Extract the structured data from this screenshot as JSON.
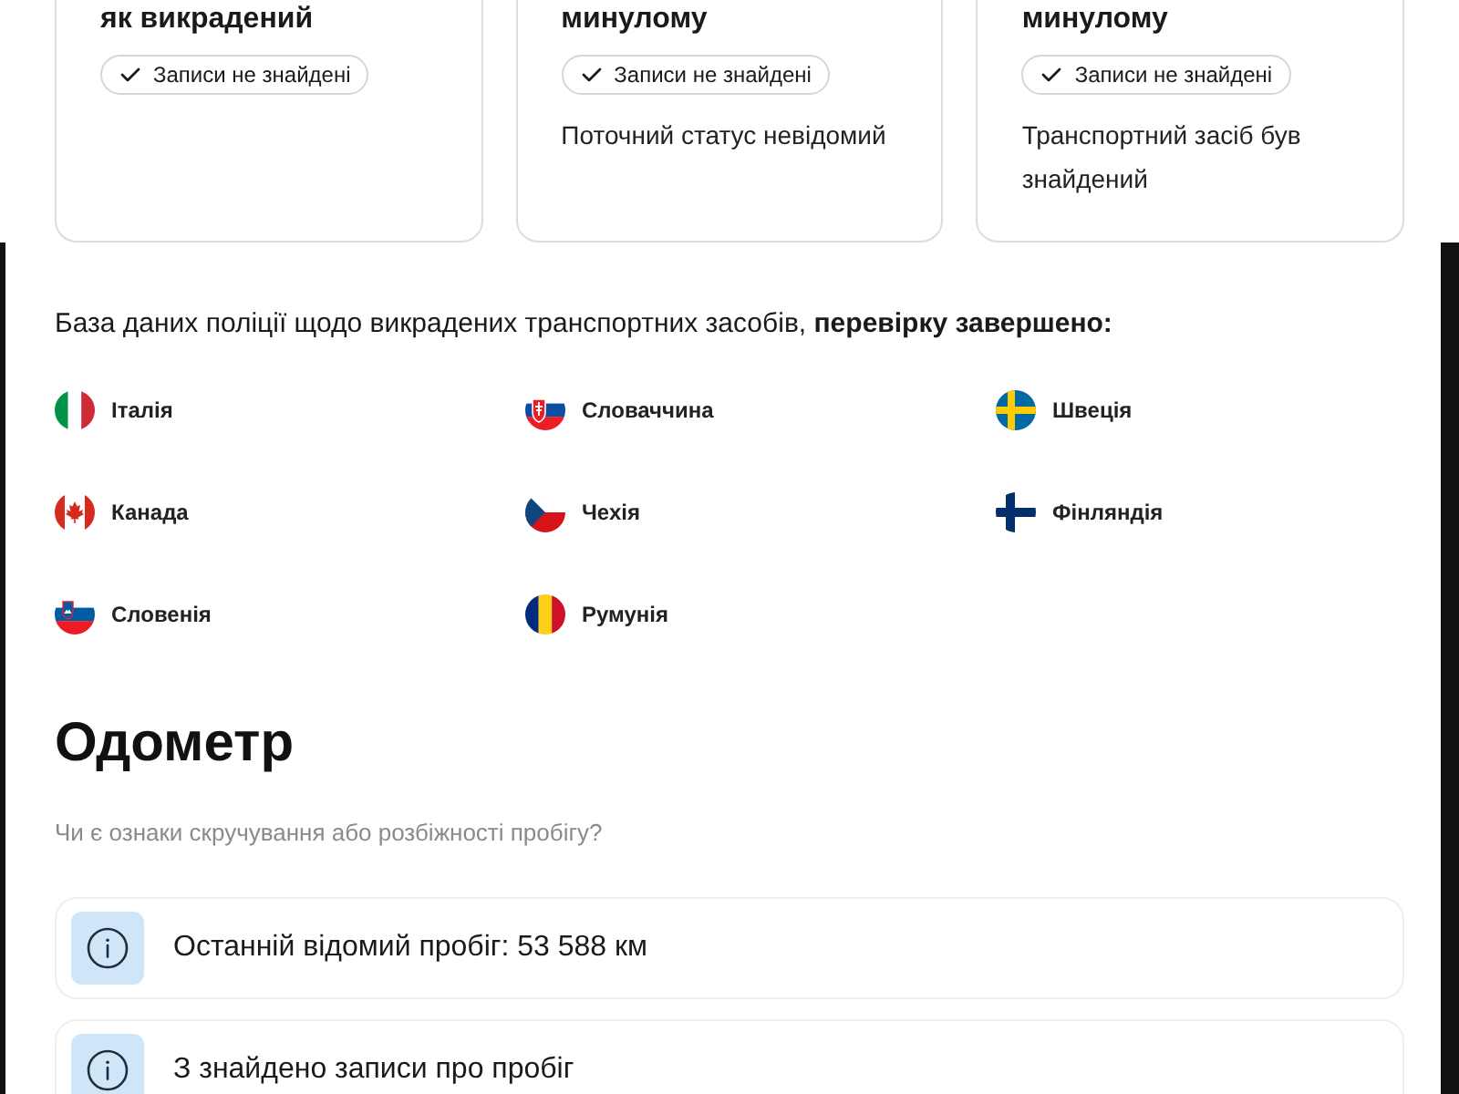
{
  "status_cards": [
    {
      "title": "як викрадений",
      "badge": "Записи не знайдені"
    },
    {
      "title": "минулому",
      "badge": "Записи не знайдені",
      "description": "Поточний статус невідомий"
    },
    {
      "title": "минулому",
      "badge": "Записи не знайдені",
      "description": "Транспортний засіб був знайдений"
    }
  ],
  "database_check": {
    "text": "База даних поліції щодо викрадених транспортних засобів, **перевірку завершено:**",
    "countries": [
      {
        "name": "Італія",
        "kind": "it"
      },
      {
        "name": "Словаччина",
        "kind": "sk"
      },
      {
        "name": "Швеція",
        "kind": "se"
      },
      {
        "name": "Канада",
        "kind": "ca"
      },
      {
        "name": "Чехія",
        "kind": "cz"
      },
      {
        "name": "Фінляндія",
        "kind": "fi"
      },
      {
        "name": "Словенія",
        "kind": "si"
      },
      {
        "name": "Румунія",
        "kind": "ro"
      }
    ]
  },
  "odometer": {
    "title": "Одометр",
    "subtitle": "Чи є ознаки скручування або розбіжності пробігу?",
    "items": [
      "Останній відомий пробіг: 53 588 км",
      "З знайдено записи про пробіг"
    ]
  }
}
